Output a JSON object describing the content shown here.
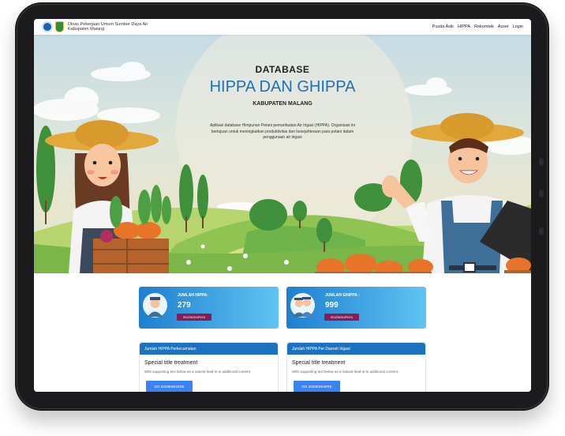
{
  "navbar": {
    "brand_line1": "Dinas Pekerjaan Umum Sumber Daya Air",
    "brand_line2": "Kabupaten Malang",
    "links": [
      "Pusda Asik",
      "HIPPA",
      "Rekomtek",
      "Asset",
      "Login"
    ]
  },
  "hero": {
    "eyebrow": "DATABASE",
    "title": "HIPPA DAN GHIPPA",
    "subtitle": "KABUPATEN MALANG",
    "description": "Aplikasi database Himpunan Petani pemanfaatan Air Irigasi (HIPPA). Organisasi ini bertujuan untuk meningkatkan produktivitas dan kesejahteraan para petani dalam penggunaan air irigasi"
  },
  "stats": [
    {
      "label": "JUMLAH HIPPA:",
      "value": "279",
      "button": "SELENGKAPNYA"
    },
    {
      "label": "JUMLAH GHIPPA :",
      "value": "999",
      "button": "SELENGKAPNYA"
    }
  ],
  "cards": [
    {
      "header": "Jumlah HIPPA Perkecamatan",
      "title": "Special title treatment",
      "text": "With supporting text below as a natural lead-in to additional content.",
      "button": "GO SOMEWHERE"
    },
    {
      "header": "Jumlah HIPPA Per Daerah Irigasi",
      "title": "Special title treatment",
      "text": "With supporting text below as a natural lead-in to additional content.",
      "button": "GO SOMEWHERE"
    }
  ],
  "colors": {
    "primary": "#1f6fb8",
    "accent_button": "#8a1c52",
    "card_header": "#1a72c1"
  }
}
